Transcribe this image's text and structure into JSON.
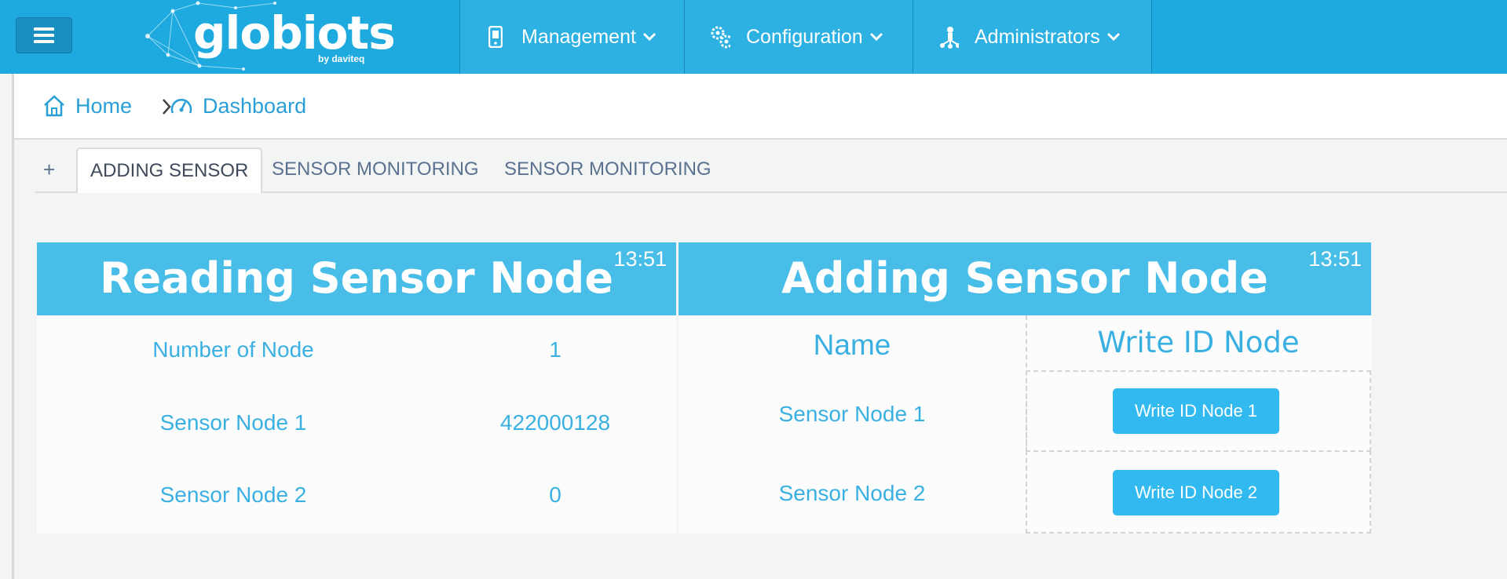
{
  "app": {
    "logo_text": "globiots",
    "logo_sub": "by daviteq"
  },
  "nav": [
    {
      "label": "Management",
      "icon": "mobile-device-icon"
    },
    {
      "label": "Configuration",
      "icon": "gears-icon"
    },
    {
      "label": "Administrators",
      "icon": "users-network-icon"
    }
  ],
  "breadcrumb": {
    "home": "Home",
    "current": "Dashboard"
  },
  "tabs": {
    "add": "+",
    "items": [
      "ADDING SENSOR",
      "SENSOR MONITORING",
      "SENSOR MONITORING"
    ]
  },
  "reading_panel": {
    "title": "Reading Sensor Node",
    "time": "13:51",
    "rows": [
      {
        "label": "Number of Node",
        "value": "1"
      },
      {
        "label": "Sensor Node 1",
        "value": "422000128"
      },
      {
        "label": "Sensor Node 2",
        "value": "0"
      }
    ]
  },
  "adding_panel": {
    "title": "Adding Sensor Node",
    "time": "13:51",
    "col_name": "Name",
    "col_write": "Write ID Node",
    "rows": [
      {
        "label": "Sensor Node 1",
        "button": "Write ID Node 1"
      },
      {
        "label": "Sensor Node 2",
        "button": "Write ID Node 2"
      }
    ]
  },
  "colors": {
    "topbar": "#1eaadf",
    "panel_header": "#47bde8",
    "accent_text": "#3ab0e2",
    "button": "#32b9ef"
  }
}
